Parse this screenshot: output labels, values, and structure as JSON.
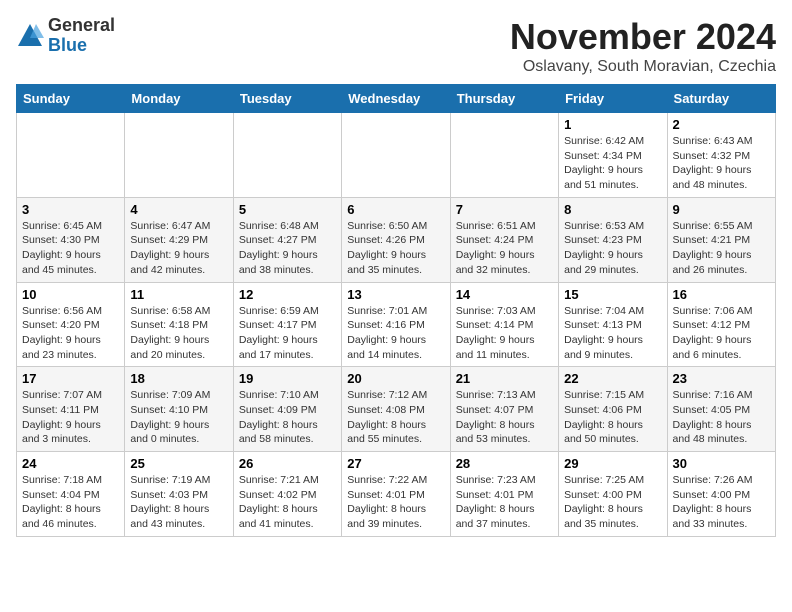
{
  "header": {
    "logo_general": "General",
    "logo_blue": "Blue",
    "month_title": "November 2024",
    "location": "Oslavany, South Moravian, Czechia"
  },
  "weekdays": [
    "Sunday",
    "Monday",
    "Tuesday",
    "Wednesday",
    "Thursday",
    "Friday",
    "Saturday"
  ],
  "weeks": [
    [
      {
        "day": "",
        "info": ""
      },
      {
        "day": "",
        "info": ""
      },
      {
        "day": "",
        "info": ""
      },
      {
        "day": "",
        "info": ""
      },
      {
        "day": "",
        "info": ""
      },
      {
        "day": "1",
        "info": "Sunrise: 6:42 AM\nSunset: 4:34 PM\nDaylight: 9 hours\nand 51 minutes."
      },
      {
        "day": "2",
        "info": "Sunrise: 6:43 AM\nSunset: 4:32 PM\nDaylight: 9 hours\nand 48 minutes."
      }
    ],
    [
      {
        "day": "3",
        "info": "Sunrise: 6:45 AM\nSunset: 4:30 PM\nDaylight: 9 hours\nand 45 minutes."
      },
      {
        "day": "4",
        "info": "Sunrise: 6:47 AM\nSunset: 4:29 PM\nDaylight: 9 hours\nand 42 minutes."
      },
      {
        "day": "5",
        "info": "Sunrise: 6:48 AM\nSunset: 4:27 PM\nDaylight: 9 hours\nand 38 minutes."
      },
      {
        "day": "6",
        "info": "Sunrise: 6:50 AM\nSunset: 4:26 PM\nDaylight: 9 hours\nand 35 minutes."
      },
      {
        "day": "7",
        "info": "Sunrise: 6:51 AM\nSunset: 4:24 PM\nDaylight: 9 hours\nand 32 minutes."
      },
      {
        "day": "8",
        "info": "Sunrise: 6:53 AM\nSunset: 4:23 PM\nDaylight: 9 hours\nand 29 minutes."
      },
      {
        "day": "9",
        "info": "Sunrise: 6:55 AM\nSunset: 4:21 PM\nDaylight: 9 hours\nand 26 minutes."
      }
    ],
    [
      {
        "day": "10",
        "info": "Sunrise: 6:56 AM\nSunset: 4:20 PM\nDaylight: 9 hours\nand 23 minutes."
      },
      {
        "day": "11",
        "info": "Sunrise: 6:58 AM\nSunset: 4:18 PM\nDaylight: 9 hours\nand 20 minutes."
      },
      {
        "day": "12",
        "info": "Sunrise: 6:59 AM\nSunset: 4:17 PM\nDaylight: 9 hours\nand 17 minutes."
      },
      {
        "day": "13",
        "info": "Sunrise: 7:01 AM\nSunset: 4:16 PM\nDaylight: 9 hours\nand 14 minutes."
      },
      {
        "day": "14",
        "info": "Sunrise: 7:03 AM\nSunset: 4:14 PM\nDaylight: 9 hours\nand 11 minutes."
      },
      {
        "day": "15",
        "info": "Sunrise: 7:04 AM\nSunset: 4:13 PM\nDaylight: 9 hours\nand 9 minutes."
      },
      {
        "day": "16",
        "info": "Sunrise: 7:06 AM\nSunset: 4:12 PM\nDaylight: 9 hours\nand 6 minutes."
      }
    ],
    [
      {
        "day": "17",
        "info": "Sunrise: 7:07 AM\nSunset: 4:11 PM\nDaylight: 9 hours\nand 3 minutes."
      },
      {
        "day": "18",
        "info": "Sunrise: 7:09 AM\nSunset: 4:10 PM\nDaylight: 9 hours\nand 0 minutes."
      },
      {
        "day": "19",
        "info": "Sunrise: 7:10 AM\nSunset: 4:09 PM\nDaylight: 8 hours\nand 58 minutes."
      },
      {
        "day": "20",
        "info": "Sunrise: 7:12 AM\nSunset: 4:08 PM\nDaylight: 8 hours\nand 55 minutes."
      },
      {
        "day": "21",
        "info": "Sunrise: 7:13 AM\nSunset: 4:07 PM\nDaylight: 8 hours\nand 53 minutes."
      },
      {
        "day": "22",
        "info": "Sunrise: 7:15 AM\nSunset: 4:06 PM\nDaylight: 8 hours\nand 50 minutes."
      },
      {
        "day": "23",
        "info": "Sunrise: 7:16 AM\nSunset: 4:05 PM\nDaylight: 8 hours\nand 48 minutes."
      }
    ],
    [
      {
        "day": "24",
        "info": "Sunrise: 7:18 AM\nSunset: 4:04 PM\nDaylight: 8 hours\nand 46 minutes."
      },
      {
        "day": "25",
        "info": "Sunrise: 7:19 AM\nSunset: 4:03 PM\nDaylight: 8 hours\nand 43 minutes."
      },
      {
        "day": "26",
        "info": "Sunrise: 7:21 AM\nSunset: 4:02 PM\nDaylight: 8 hours\nand 41 minutes."
      },
      {
        "day": "27",
        "info": "Sunrise: 7:22 AM\nSunset: 4:01 PM\nDaylight: 8 hours\nand 39 minutes."
      },
      {
        "day": "28",
        "info": "Sunrise: 7:23 AM\nSunset: 4:01 PM\nDaylight: 8 hours\nand 37 minutes."
      },
      {
        "day": "29",
        "info": "Sunrise: 7:25 AM\nSunset: 4:00 PM\nDaylight: 8 hours\nand 35 minutes."
      },
      {
        "day": "30",
        "info": "Sunrise: 7:26 AM\nSunset: 4:00 PM\nDaylight: 8 hours\nand 33 minutes."
      }
    ]
  ]
}
